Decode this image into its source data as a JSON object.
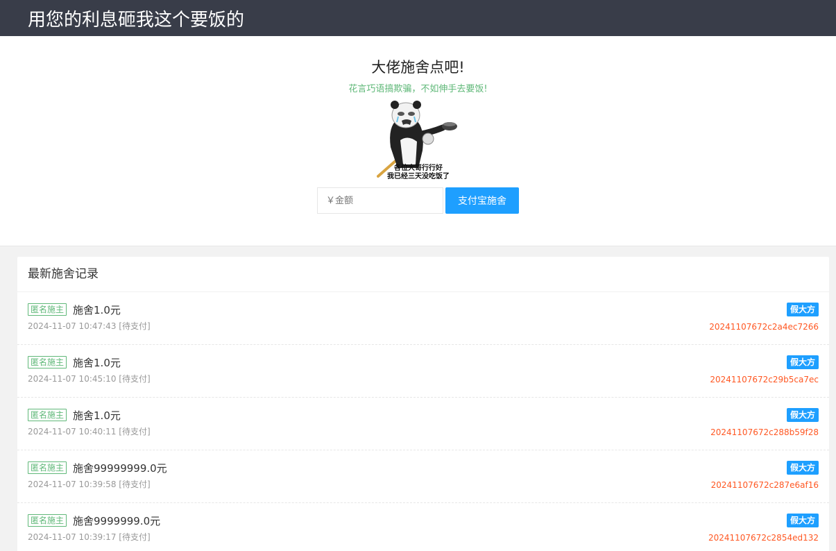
{
  "header": {
    "title": "用您的利息砸我这个要饭的"
  },
  "hero": {
    "title": "大佬施舍点吧!",
    "subtitle": "花言巧语搞欺骗，不如伸手去要饭!",
    "image_caption_line1": "各位大哥行行好",
    "image_caption_line2": "我已经三天没吃饭了",
    "amount_placeholder": "￥金额",
    "amount_value": "",
    "pay_button": "支付宝施舍"
  },
  "records_panel": {
    "title": "最新施舍记录",
    "records": [
      {
        "donor": "匿名施主",
        "amount": "施舍1.0元",
        "time": "2024-11-07 10:47:43",
        "status": "[待支付]",
        "badge": "假大方",
        "order": "20241107672c2a4ec7266"
      },
      {
        "donor": "匿名施主",
        "amount": "施舍1.0元",
        "time": "2024-11-07 10:45:10",
        "status": "[待支付]",
        "badge": "假大方",
        "order": "20241107672c29b5ca7ec"
      },
      {
        "donor": "匿名施主",
        "amount": "施舍1.0元",
        "time": "2024-11-07 10:40:11",
        "status": "[待支付]",
        "badge": "假大方",
        "order": "20241107672c288b59f28"
      },
      {
        "donor": "匿名施主",
        "amount": "施舍99999999.0元",
        "time": "2024-11-07 10:39:58",
        "status": "[待支付]",
        "badge": "假大方",
        "order": "20241107672c287e6af16"
      },
      {
        "donor": "匿名施主",
        "amount": "施舍9999999.0元",
        "time": "2024-11-07 10:39:17",
        "status": "[待支付]",
        "badge": "假大方",
        "order": "20241107672c2854ed132"
      }
    ]
  },
  "colors": {
    "header_bg": "#393d49",
    "accent_blue": "#1e9fff",
    "accent_green": "#5fb878",
    "order_red": "#ff5722"
  }
}
